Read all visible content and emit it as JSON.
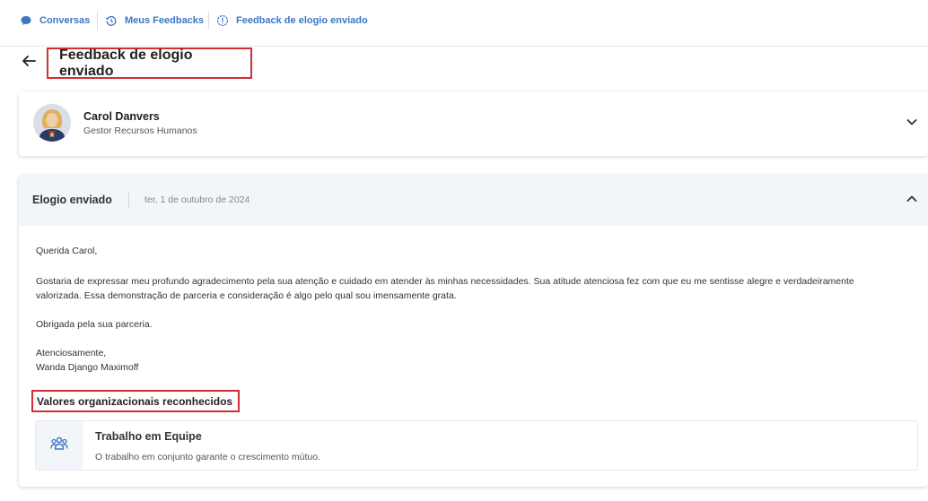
{
  "breadcrumb": {
    "items": [
      {
        "label": "Conversas",
        "icon": "chat-bubble-icon"
      },
      {
        "label": "Meus Feedbacks",
        "icon": "history-icon"
      },
      {
        "label": "Feedback de elogio enviado",
        "icon": "alert-badge-icon"
      }
    ]
  },
  "page": {
    "title": "Feedback de elogio enviado"
  },
  "person": {
    "name": "Carol Danvers",
    "role": "Gestor Recursos Humanos"
  },
  "feedback": {
    "type_label": "Elogio enviado",
    "date": "ter, 1 de outubro de 2024",
    "greeting": "Querida Carol,",
    "paragraph1_line1": "Gostaria de expressar meu profundo agradecimento pela sua atenção e cuidado em atender às minhas necessidades. Sua atitude atenciosa fez com que eu me sentisse alegre e verdadeiramente",
    "paragraph1_line2": "valorizada. Essa demonstração de parceria e consideração é algo pelo qual sou imensamente grata.",
    "paragraph2": "Obrigada pela sua parceria.",
    "closing": "Atenciosamente,",
    "signature": "Wanda Django Maximoff"
  },
  "values": {
    "title": "Valores organizacionais reconhecidos",
    "items": [
      {
        "name": "Trabalho em Equipe",
        "description": "O trabalho em conjunto garante o crescimento mútuo.",
        "icon": "team-icon"
      }
    ]
  },
  "colors": {
    "accent": "#3d76c4",
    "highlight_border": "#d32f2f",
    "header_bg": "#f2f5fa"
  }
}
